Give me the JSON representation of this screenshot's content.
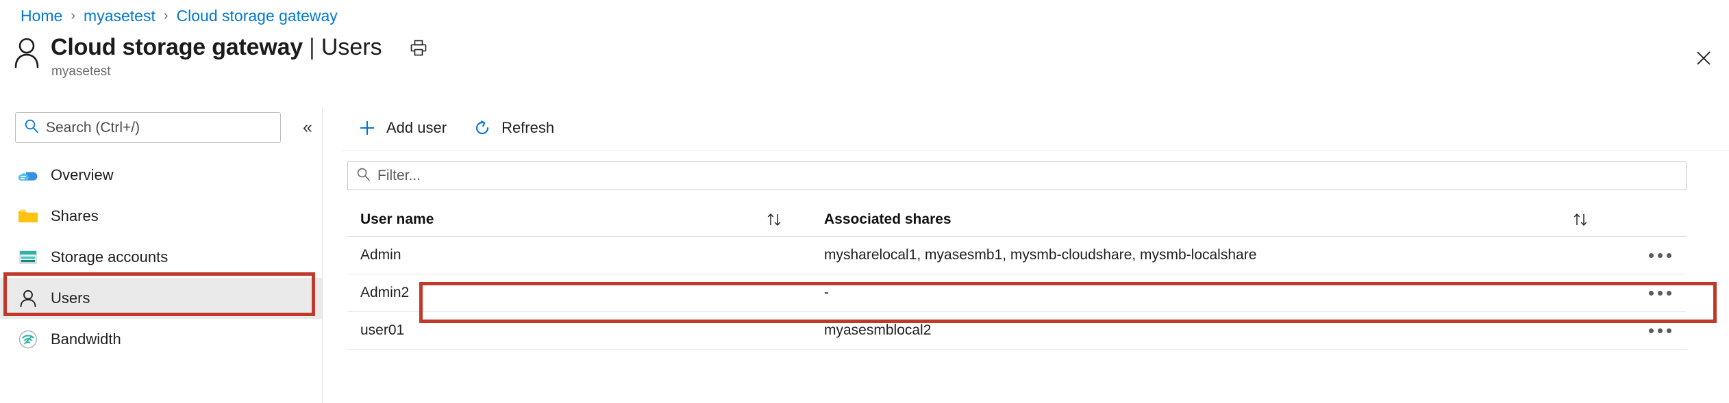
{
  "breadcrumb": {
    "items": [
      {
        "label": "Home"
      },
      {
        "label": "myasetest"
      },
      {
        "label": "Cloud storage gateway"
      }
    ],
    "separator": "›"
  },
  "header": {
    "avatar_icon": "user-avatar-icon",
    "title": "Cloud storage gateway",
    "title_separator": "|",
    "page_name": "Users",
    "subtitle": "myasetest",
    "print_icon": "printer-icon",
    "close_icon": "close-icon"
  },
  "left_pane": {
    "search": {
      "icon": "search-icon",
      "placeholder": "Search (Ctrl+/)",
      "value": ""
    },
    "collapse_icon": "chevron-double-left-icon",
    "nav_items": [
      {
        "label": "Overview",
        "icon": "cloud-icon",
        "selected": false
      },
      {
        "label": "Shares",
        "icon": "folder-icon",
        "selected": false
      },
      {
        "label": "Storage accounts",
        "icon": "storage-account-icon",
        "selected": false
      },
      {
        "label": "Users",
        "icon": "user-icon",
        "selected": true
      },
      {
        "label": "Bandwidth",
        "icon": "bandwidth-icon",
        "selected": false
      }
    ]
  },
  "toolbar": {
    "add_user_label": "Add user",
    "add_user_icon": "plus-icon",
    "refresh_label": "Refresh",
    "refresh_icon": "refresh-icon"
  },
  "filter": {
    "icon": "search-icon",
    "placeholder": "Filter...",
    "value": ""
  },
  "table": {
    "columns": [
      {
        "label": "User name",
        "sort_icon": "sort-ascending-descending-icon"
      },
      {
        "label": "Associated shares",
        "sort_icon": "sort-ascending-descending-icon"
      }
    ],
    "row_menu_icon": "more-options-icon",
    "rows": [
      {
        "user_name": "Admin",
        "associated_shares": "mysharelocal1, myasesmb1, mysmb-cloudshare, mysmb-localshare"
      },
      {
        "user_name": "Admin2",
        "associated_shares": "-"
      },
      {
        "user_name": "user01",
        "associated_shares": "myasesmblocal2"
      }
    ]
  },
  "annotations": {
    "color": "#c0392b",
    "targets": [
      "sidebar-item-users",
      "table-row-admin2"
    ]
  },
  "colors": {
    "link": "#0078d4",
    "accent": "#0078d4",
    "annotation": "#c0392b",
    "selected_row_bg": "#eaeaea",
    "folder_icon": "#ffb900",
    "cloud_icon": "#0078d4",
    "storage_icon": "#2bb3a3"
  }
}
